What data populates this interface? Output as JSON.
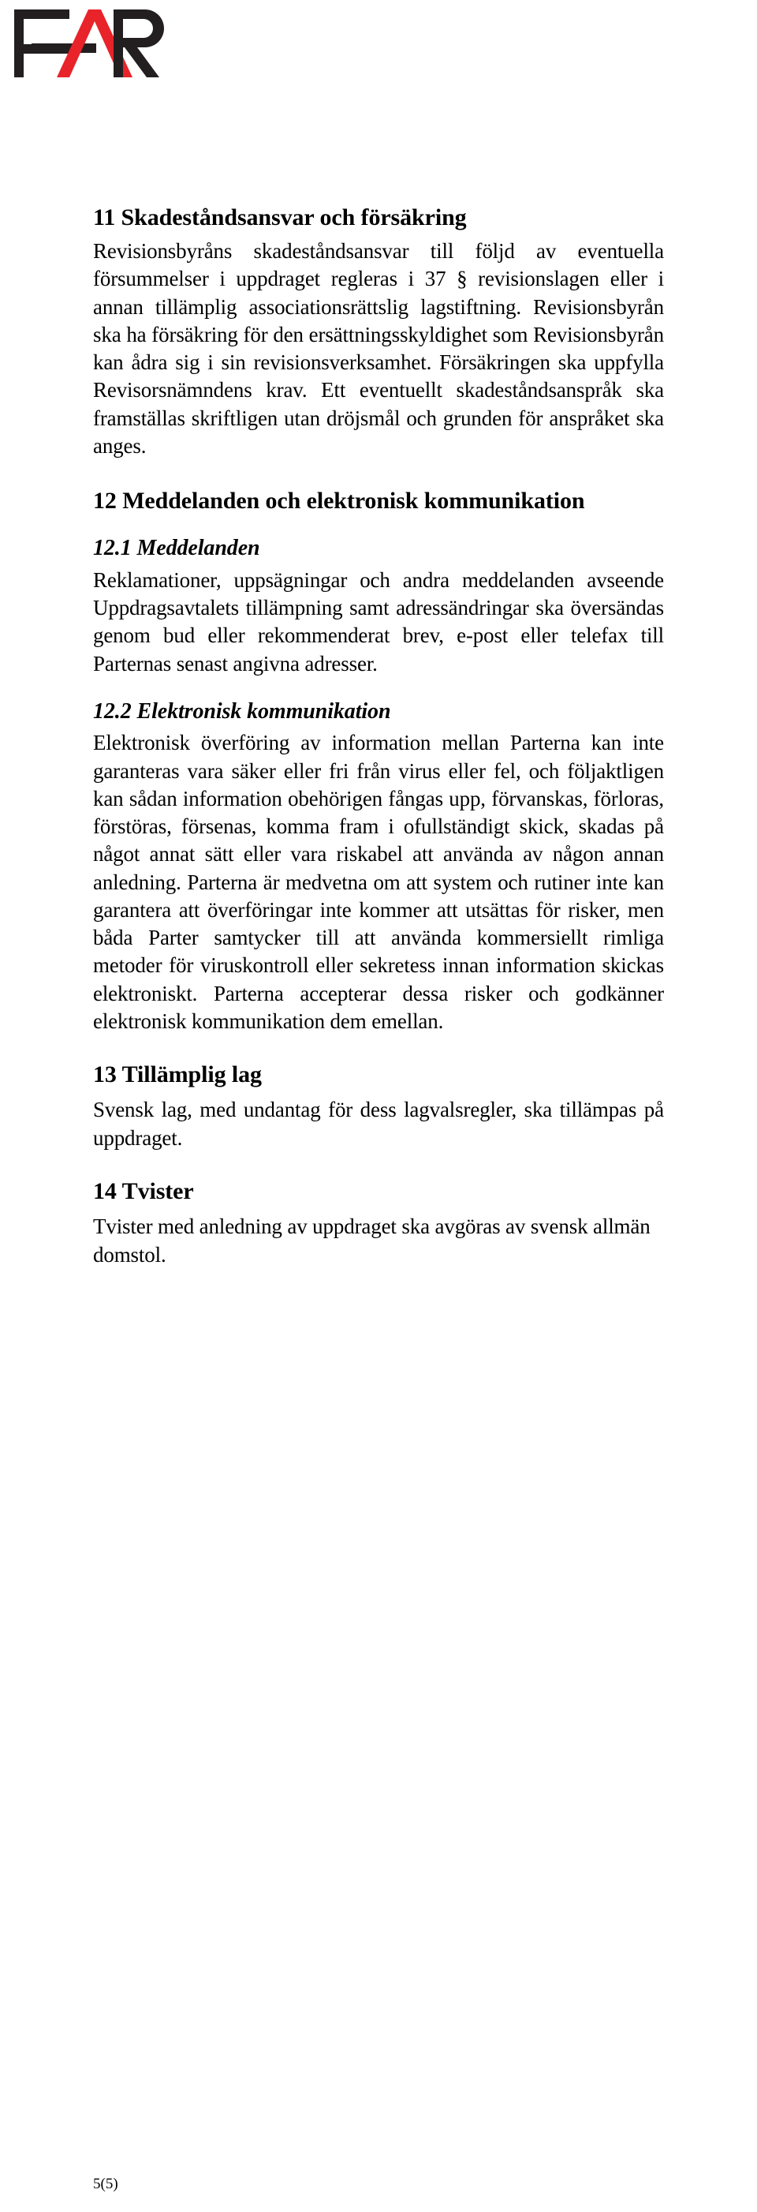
{
  "logo": {
    "name": "far-logo",
    "letters": "FAR",
    "colors": {
      "dark": "#231f20",
      "red": "#e8232a"
    }
  },
  "document": {
    "sections": [
      {
        "id": "sec-11",
        "heading": "11 Skadeståndsansvar och försäkring",
        "paragraphs": [
          "Revisionsbyråns skadeståndsansvar till följd av eventuella försummelser i uppdraget regleras i 37 § revisionslagen eller i annan tillämplig associationsrättslig lagstiftning. Revisionsbyrån ska ha försäkring för den ersättningsskyldighet som Revisionsbyrån kan ådra sig i sin revisionsverksamhet. Försäkringen ska uppfylla Revisorsnämndens krav. Ett eventuellt skadeståndsanspråk ska framställas skriftligen utan dröjsmål och grunden för anspråket ska anges."
        ]
      },
      {
        "id": "sec-12",
        "heading": "12 Meddelanden och elektronisk kommunikation",
        "subsections": [
          {
            "id": "sec-12-1",
            "heading": "12.1 Meddelanden",
            "paragraphs": [
              "Reklamationer, uppsägningar och andra meddelanden avseende Uppdragsavtalets tillämpning samt adressändringar ska översändas genom bud eller rekommenderat brev, e-post eller telefax till Parternas senast angivna adresser."
            ]
          },
          {
            "id": "sec-12-2",
            "heading": "12.2 Elektronisk kommunikation",
            "paragraphs": [
              "Elektronisk överföring av information mellan Parterna kan inte garanteras vara säker eller fri från virus eller fel, och följaktligen kan sådan information obehörigen fångas upp, förvanskas, förloras, förstöras, försenas, komma fram i ofullständigt skick, skadas på något annat sätt eller vara riskabel att använda av någon annan anledning. Parterna är medvetna om att system och rutiner inte kan garantera att överföringar inte kommer att utsättas för risker, men båda Parter samtycker till att använda kommersiellt rimliga metoder för viruskontroll eller sekretess innan information skickas elektroniskt. Parterna accepterar dessa risker och godkänner elektronisk kommunikation dem emellan."
            ]
          }
        ]
      },
      {
        "id": "sec-13",
        "heading": "13 Tillämplig lag",
        "paragraphs": [
          "Svensk lag, med undantag för dess lagvalsregler, ska tillämpas på uppdraget."
        ]
      },
      {
        "id": "sec-14",
        "heading": "14 Tvister",
        "paragraphs": [
          "Tvister med anledning av uppdraget ska avgöras av svensk allmän domstol."
        ]
      }
    ]
  },
  "footer": {
    "page_label": "5(5)"
  }
}
